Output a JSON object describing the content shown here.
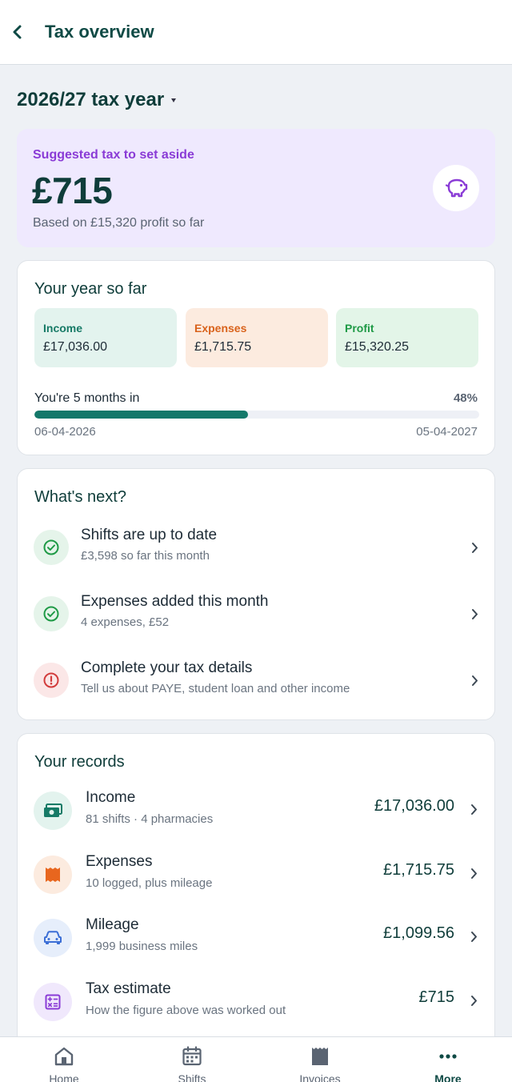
{
  "header": {
    "title": "Tax overview",
    "back_icon": "chevron-left-icon"
  },
  "tax_year": {
    "label": "2026/27 tax year"
  },
  "suggested": {
    "label": "Suggested tax to set aside",
    "amount": "£715",
    "basis": "Based on £15,320 profit so far",
    "icon": "piggy-bank-icon"
  },
  "year_so_far": {
    "title": "Your year so far",
    "stats": [
      {
        "label": "Income",
        "value": "£17,036.00"
      },
      {
        "label": "Expenses",
        "value": "£1,715.75"
      },
      {
        "label": "Profit",
        "value": "£15,320.25"
      }
    ],
    "progress_text": "You're 5 months in",
    "progress_pct": "48%",
    "progress_fraction": 0.48,
    "start_date": "06-04-2026",
    "end_date": "05-04-2027"
  },
  "whats_next": {
    "title": "What's next?",
    "items": [
      {
        "title": "Shifts are up to date",
        "sub": "£3,598 so far this month",
        "status": "ok"
      },
      {
        "title": "Expenses added this month",
        "sub": "4 expenses, £52",
        "status": "ok"
      },
      {
        "title": "Complete your tax details",
        "sub": "Tell us about PAYE, student loan and other income",
        "status": "warn"
      }
    ]
  },
  "records": {
    "title": "Your records",
    "items": [
      {
        "title": "Income",
        "sub": "81 shifts · 4 pharmacies",
        "amount": "£17,036.00",
        "icon": "cash-icon"
      },
      {
        "title": "Expenses",
        "sub": "10 logged, plus mileage",
        "amount": "£1,715.75",
        "icon": "receipt-icon"
      },
      {
        "title": "Mileage",
        "sub": "1,999 business miles",
        "amount": "£1,099.56",
        "icon": "car-icon"
      },
      {
        "title": "Tax estimate",
        "sub": "How the figure above was worked out",
        "amount": "£715",
        "icon": "calculator-icon"
      }
    ]
  },
  "nav": {
    "items": [
      {
        "label": "Home",
        "icon": "home-icon"
      },
      {
        "label": "Shifts",
        "icon": "calendar-icon"
      },
      {
        "label": "Invoices",
        "icon": "invoice-icon"
      },
      {
        "label": "More",
        "icon": "more-dots-icon",
        "active": true
      }
    ]
  },
  "colors": {
    "primary": "#0f4a45",
    "accent_purple": "#8a3bd6",
    "progress": "#14786a",
    "income": "#167a66",
    "expenses": "#d9621b",
    "profit": "#1f9a46",
    "warn": "#d23c3c"
  }
}
